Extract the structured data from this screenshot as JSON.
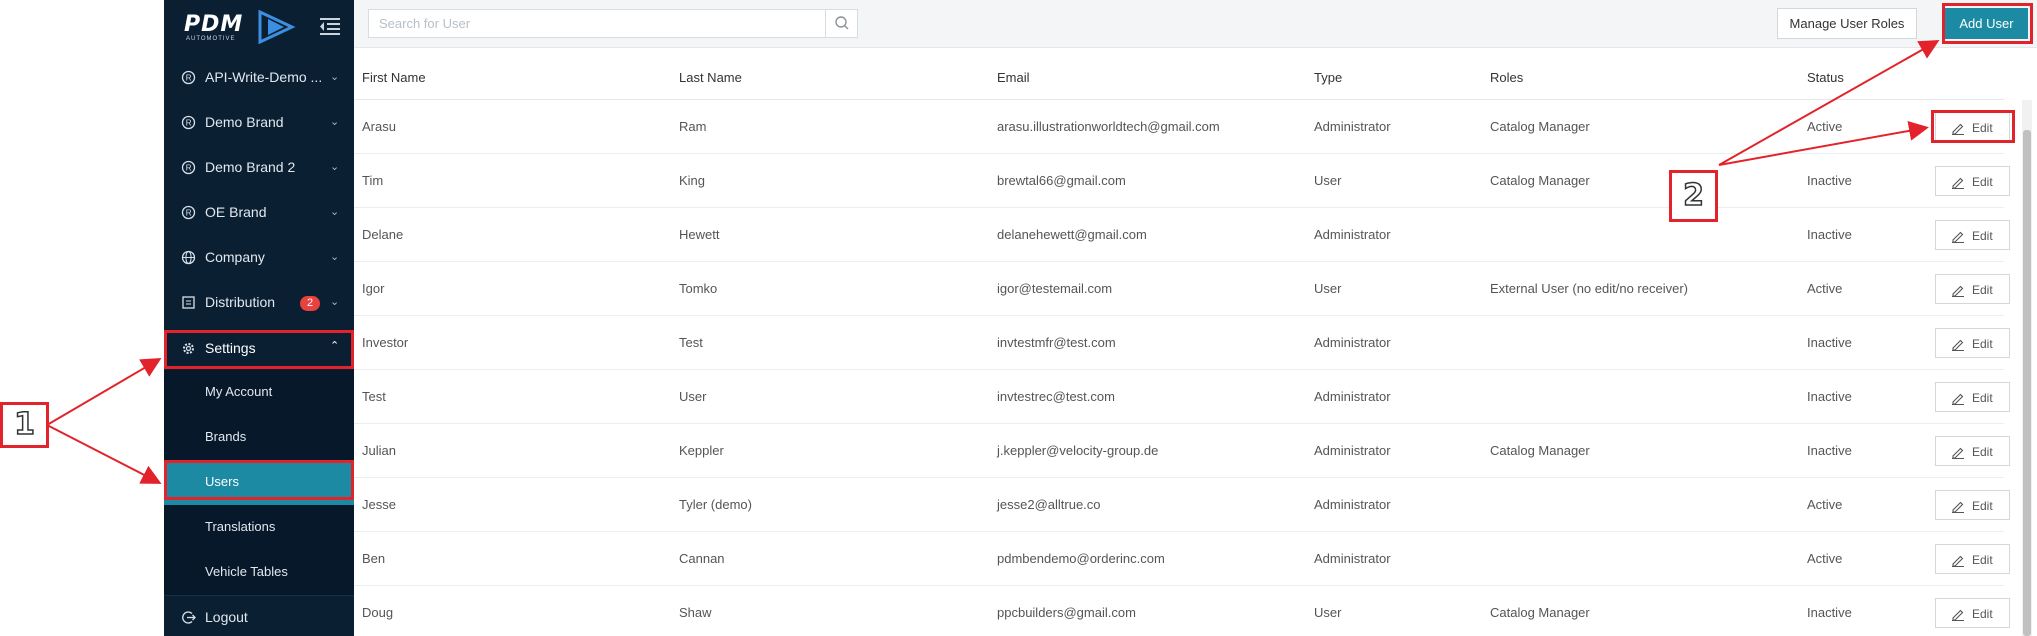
{
  "logo": {
    "text": "PDM",
    "sub": "AUTOMOTIVE"
  },
  "sidebar": {
    "items": [
      {
        "label": "API-Write-Demo ...",
        "icon": "registered-icon"
      },
      {
        "label": "Demo Brand",
        "icon": "registered-icon"
      },
      {
        "label": "Demo Brand 2",
        "icon": "registered-icon"
      },
      {
        "label": "OE Brand",
        "icon": "registered-icon"
      },
      {
        "label": "Company",
        "icon": "globe-icon"
      },
      {
        "label": "Distribution",
        "icon": "distribution-icon",
        "badge": "2"
      }
    ],
    "settings": {
      "label": "Settings",
      "icon": "gear-icon"
    },
    "sub_items": [
      {
        "label": "My Account"
      },
      {
        "label": "Brands"
      },
      {
        "label": "Users",
        "active": true
      },
      {
        "label": "Translations"
      },
      {
        "label": "Vehicle Tables"
      }
    ],
    "logout": {
      "label": "Logout"
    }
  },
  "toolbar": {
    "search_placeholder": "Search for User",
    "manage_label": "Manage User Roles",
    "add_label": "Add User"
  },
  "table": {
    "headers": {
      "first": "First Name",
      "last": "Last Name",
      "email": "Email",
      "type": "Type",
      "roles": "Roles",
      "status": "Status"
    },
    "edit_label": "Edit",
    "rows": [
      {
        "first": "Arasu",
        "last": "Ram",
        "email": "arasu.illustrationworldtech@gmail.com",
        "type": "Administrator",
        "roles": "Catalog Manager",
        "status": "Active"
      },
      {
        "first": "Tim",
        "last": "King",
        "email": "brewtal66@gmail.com",
        "type": "User",
        "roles": "Catalog Manager",
        "status": "Inactive"
      },
      {
        "first": "Delane",
        "last": "Hewett",
        "email": "delanehewett@gmail.com",
        "type": "Administrator",
        "roles": "",
        "status": "Inactive"
      },
      {
        "first": "Igor",
        "last": "Tomko",
        "email": "igor@testemail.com",
        "type": "User",
        "roles": "External User (no edit/no receiver)",
        "status": "Active"
      },
      {
        "first": "Investor",
        "last": "Test",
        "email": "invtestmfr@test.com",
        "type": "Administrator",
        "roles": "",
        "status": "Inactive"
      },
      {
        "first": "Test",
        "last": "User",
        "email": "invtestrec@test.com",
        "type": "Administrator",
        "roles": "",
        "status": "Inactive"
      },
      {
        "first": "Julian",
        "last": "Keppler",
        "email": "j.keppler@velocity-group.de",
        "type": "Administrator",
        "roles": "Catalog Manager",
        "status": "Inactive"
      },
      {
        "first": "Jesse",
        "last": "Tyler (demo)",
        "email": "jesse2@alltrue.co",
        "type": "Administrator",
        "roles": "",
        "status": "Active"
      },
      {
        "first": "Ben",
        "last": "Cannan",
        "email": "pdmbendemo@orderinc.com",
        "type": "Administrator",
        "roles": "",
        "status": "Active"
      },
      {
        "first": "Doug",
        "last": "Shaw",
        "email": "ppcbuilders@gmail.com",
        "type": "User",
        "roles": "Catalog Manager",
        "status": "Inactive"
      }
    ]
  },
  "annotations": {
    "step1": "1",
    "step2": "2",
    "color": "#e3232b"
  },
  "colors": {
    "sidebar_bg": "#0b1f33",
    "accent": "#1c8aa3",
    "badge": "#e8423f"
  }
}
